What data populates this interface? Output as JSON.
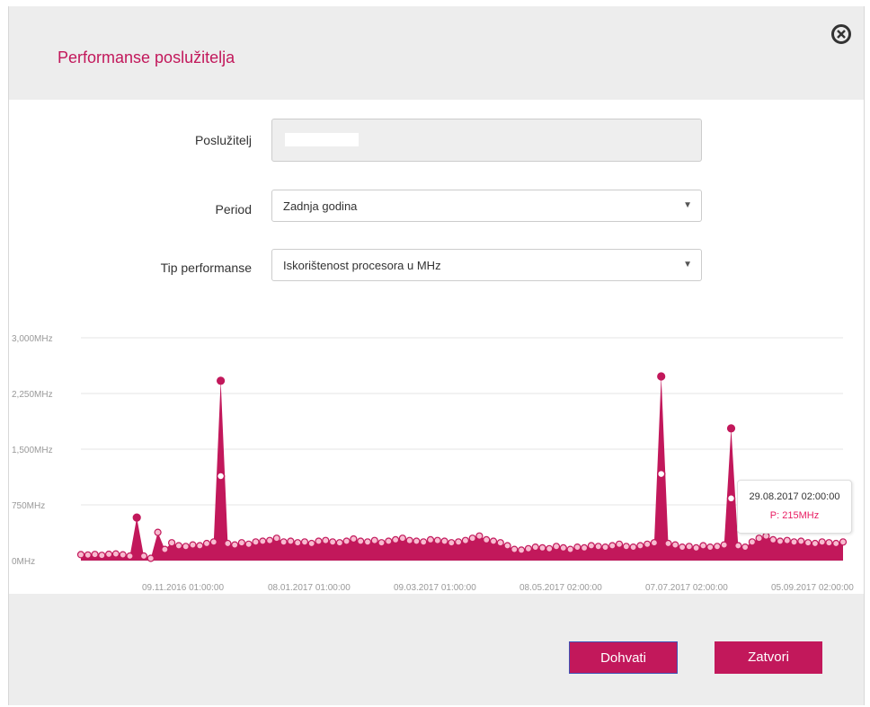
{
  "modal": {
    "title": "Performanse poslužitelja",
    "close_icon": "close-circle-icon"
  },
  "form": {
    "server": {
      "label": "Poslužitelj",
      "value": ""
    },
    "period": {
      "label": "Period",
      "value": "Zadnja godina"
    },
    "type": {
      "label": "Tip performanse",
      "value": "Iskorištenost procesora u MHz"
    }
  },
  "chart_data": {
    "type": "area",
    "y_ticks": [
      "3,000MHz",
      "2,250MHz",
      "1,500MHz",
      "750MHz",
      "0MHz"
    ],
    "x_ticks": [
      "09.11.2016 01:00:00",
      "08.01.2017 01:00:00",
      "09.03.2017 01:00:00",
      "08.05.2017 02:00:00",
      "07.07.2017 02:00:00",
      "05.09.2017 02:00:00"
    ],
    "ylim": [
      0,
      3000
    ],
    "grid": true,
    "color": "#c2185b",
    "series": [
      {
        "values": [
          80,
          75,
          82,
          70,
          85,
          90,
          78,
          60,
          580,
          60,
          30,
          380,
          150,
          240,
          200,
          190,
          210,
          200,
          230,
          250,
          2420,
          230,
          210,
          240,
          220,
          250,
          260,
          270,
          300,
          250,
          260,
          240,
          250,
          230,
          260,
          270,
          250,
          240,
          260,
          290,
          260,
          250,
          270,
          240,
          260,
          280,
          300,
          270,
          260,
          250,
          280,
          270,
          260,
          240,
          250,
          270,
          300,
          330,
          280,
          260,
          240,
          200,
          150,
          140,
          160,
          180,
          170,
          160,
          190,
          170,
          150,
          180,
          170,
          200,
          190,
          180,
          200,
          220,
          190,
          180,
          200,
          220,
          240,
          2480,
          230,
          210,
          180,
          190,
          170,
          200,
          180,
          190,
          210,
          1780,
          200,
          180,
          250,
          300,
          330,
          280,
          260,
          270,
          250,
          260,
          240,
          230,
          250,
          240,
          230,
          250
        ]
      }
    ],
    "tooltip": {
      "date": "29.08.2017 02:00:00",
      "value": "P: 215MHz"
    }
  },
  "buttons": {
    "fetch": "Dohvati",
    "close": "Zatvori"
  },
  "colors": {
    "accent": "#c2185b",
    "header_bg": "#ededed"
  }
}
